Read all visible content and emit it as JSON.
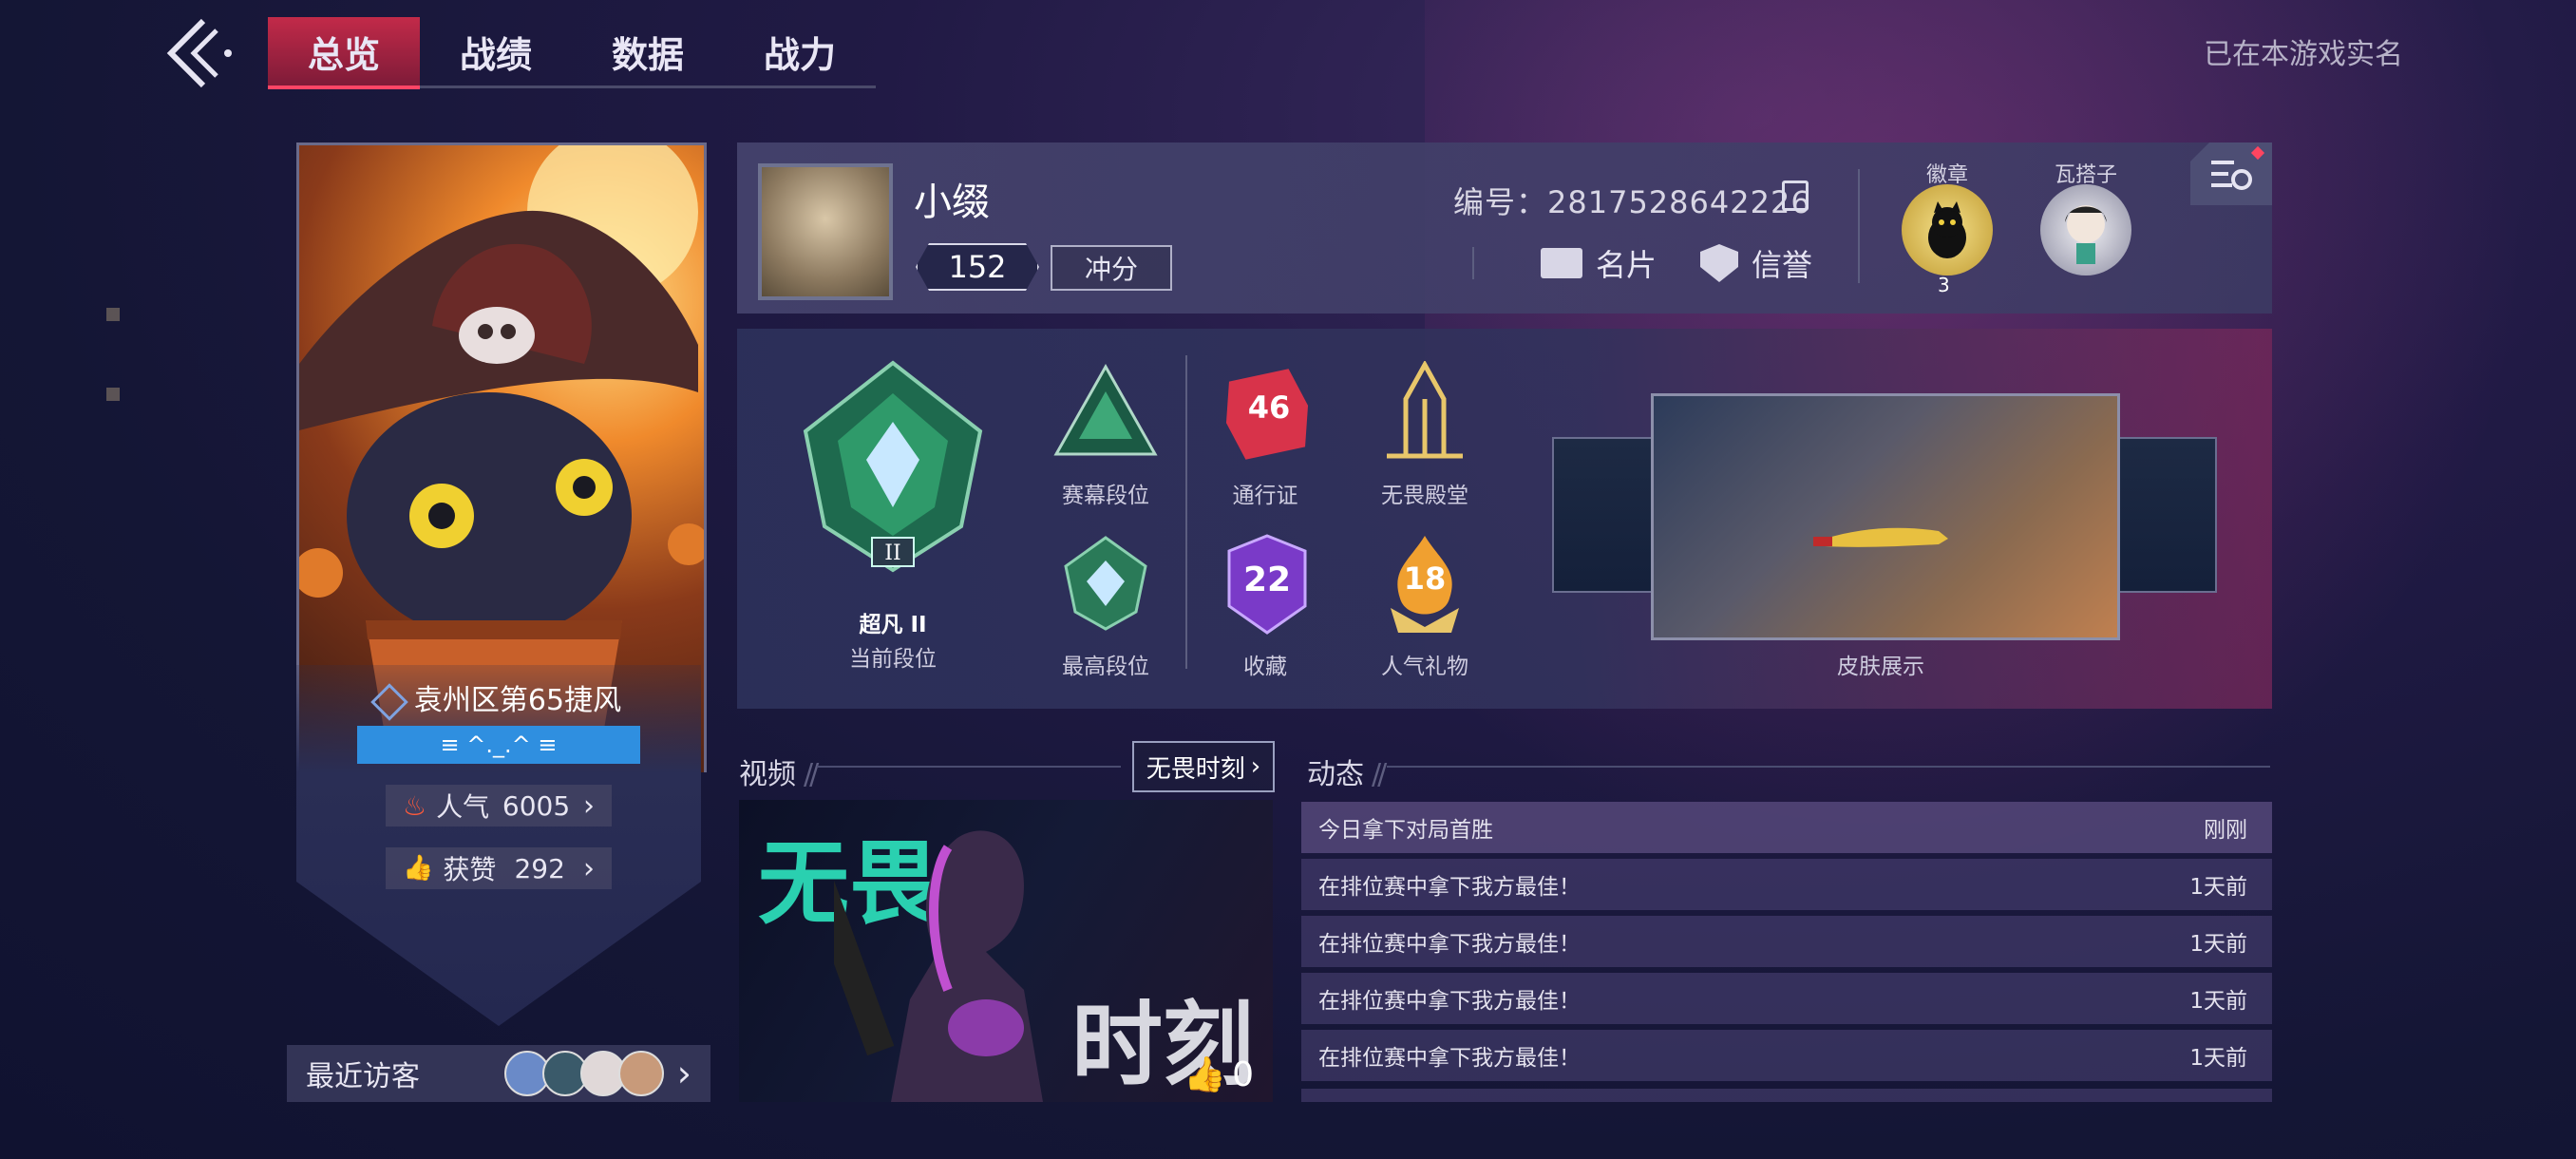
{
  "nav": {
    "tabs": [
      {
        "label": "总览",
        "active": true
      },
      {
        "label": "战绩",
        "active": false
      },
      {
        "label": "数据",
        "active": false
      },
      {
        "label": "战力",
        "active": false
      }
    ],
    "realname_status": "已在本游戏实名"
  },
  "hero_card": {
    "title": "袁州区第65捷风",
    "signature": "≡ ^._.^ ≡",
    "popularity_label": "人气",
    "popularity_value": "6005",
    "likes_label": "获赞",
    "likes_value": "292"
  },
  "visitors": {
    "label": "最近访客"
  },
  "profile": {
    "nickname": "小缀",
    "level": "152",
    "chongfen_label": "冲分",
    "uid_text": "编号：2817528642226",
    "namecard_label": "名片",
    "credit_label": "信誉",
    "badge_label": "徽章",
    "badge_count": "3",
    "wazi_label": "瓦搭子"
  },
  "ranks": {
    "current_tier": "超凡 II",
    "current_label": "当前段位",
    "season_label": "赛幕段位",
    "highest_label": "最高段位",
    "pass_label": "通行证",
    "pass_value": "46",
    "hall_label": "无畏殿堂",
    "collection_label": "收藏",
    "collection_value": "22",
    "gift_label": "人气礼物",
    "gift_value": "18",
    "skin_label": "皮肤展示"
  },
  "video": {
    "title": "视频",
    "button_label": "无畏时刻",
    "like_count": "0",
    "thumb_text_1": "无畏",
    "thumb_text_2": "时刻"
  },
  "feed": {
    "title": "动态",
    "items": [
      {
        "text": "今日拿下对局首胜",
        "time": "刚刚"
      },
      {
        "text": "在排位赛中拿下我方最佳！",
        "time": "1天前"
      },
      {
        "text": "在排位赛中拿下我方最佳！",
        "time": "1天前"
      },
      {
        "text": "在排位赛中拿下我方最佳！",
        "time": "1天前"
      },
      {
        "text": "在排位赛中拿下我方最佳！",
        "time": "1天前"
      }
    ]
  },
  "colors": {
    "accent": "#c22a49",
    "signature_bar": "#2f8fe0",
    "gold": "#e8c66a"
  }
}
